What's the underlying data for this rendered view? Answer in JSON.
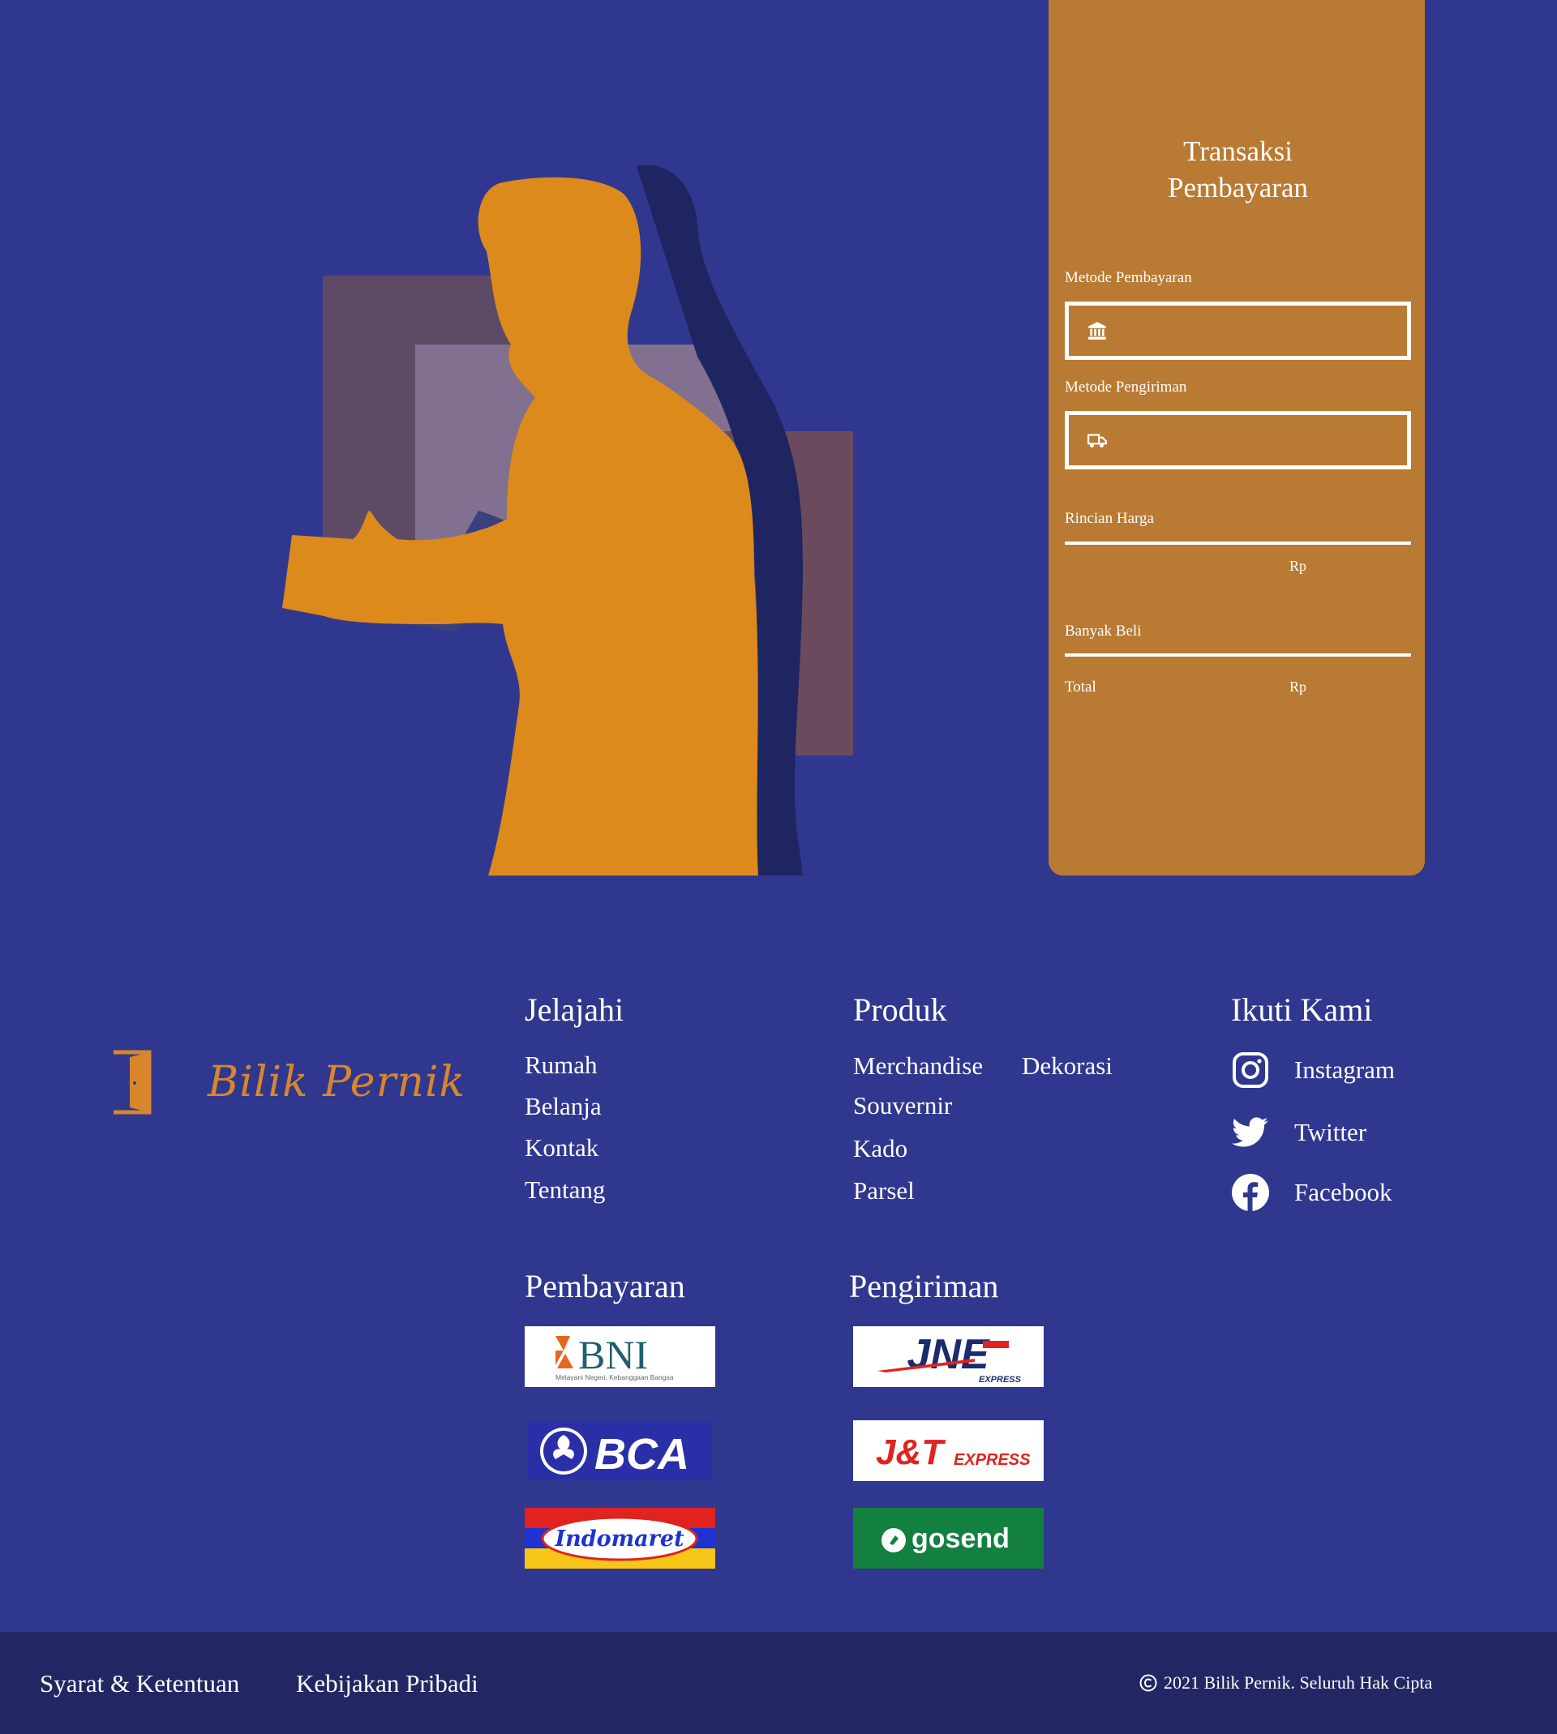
{
  "payment": {
    "title_line1": "Transaksi",
    "title_line2": "Pembayaran",
    "payment_method_label": "Metode Pembayaran",
    "shipping_method_label": "Metode Pengiriman",
    "price_details_label": "Rincian Harga",
    "price_currency": "Rp",
    "quantity_label": "Banyak Beli",
    "total_label": "Total",
    "total_currency": "Rp"
  },
  "brand": {
    "name": "Bilik Pernik",
    "color": "#d8862b"
  },
  "footer": {
    "explore": {
      "title": "Jelajahi",
      "links": [
        "Rumah",
        "Belanja",
        "Kontak",
        "Tentang"
      ]
    },
    "products": {
      "title": "Produk",
      "links": [
        "Merchandise",
        "Dekorasi",
        "Souvernir",
        "Kado",
        "Parsel"
      ]
    },
    "follow": {
      "title": "Ikuti Kami",
      "links": [
        "Instagram",
        "Twitter",
        "Facebook"
      ]
    },
    "payments": {
      "title": "Pembayaran",
      "logos": [
        "BNI",
        "BCA",
        "Indomaret"
      ]
    },
    "shipping": {
      "title": "Pengiriman",
      "logos": [
        "JNE",
        "J&T EXPRESS",
        "gosend"
      ]
    },
    "bottom": {
      "terms": "Syarat & Ketentuan",
      "privacy": "Kebijakan Pribadi",
      "copyright": "2021 Bilik Pernik. Seluruh Hak Cipta"
    }
  },
  "logos": {
    "bni_text": "BNI",
    "bni_tagline": "Melayani Negeri, Kebanggaan Bangsa",
    "bca_text": "BCA",
    "indomaret_text": "Indomaret",
    "jne_text": "JNE",
    "jne_sub": "EXPRESS",
    "jnt_text": "J&T",
    "jnt_sub": "EXPRESS",
    "gosend_text": "gosend"
  },
  "colors": {
    "background": "#30378f",
    "card": "#b97a33",
    "accent": "#d8862b",
    "bottom_bar": "#222764"
  },
  "icons": {
    "payment_field": "bank-icon",
    "shipping_field": "truck-icon",
    "social": [
      "instagram-icon",
      "twitter-icon",
      "facebook-icon"
    ]
  }
}
